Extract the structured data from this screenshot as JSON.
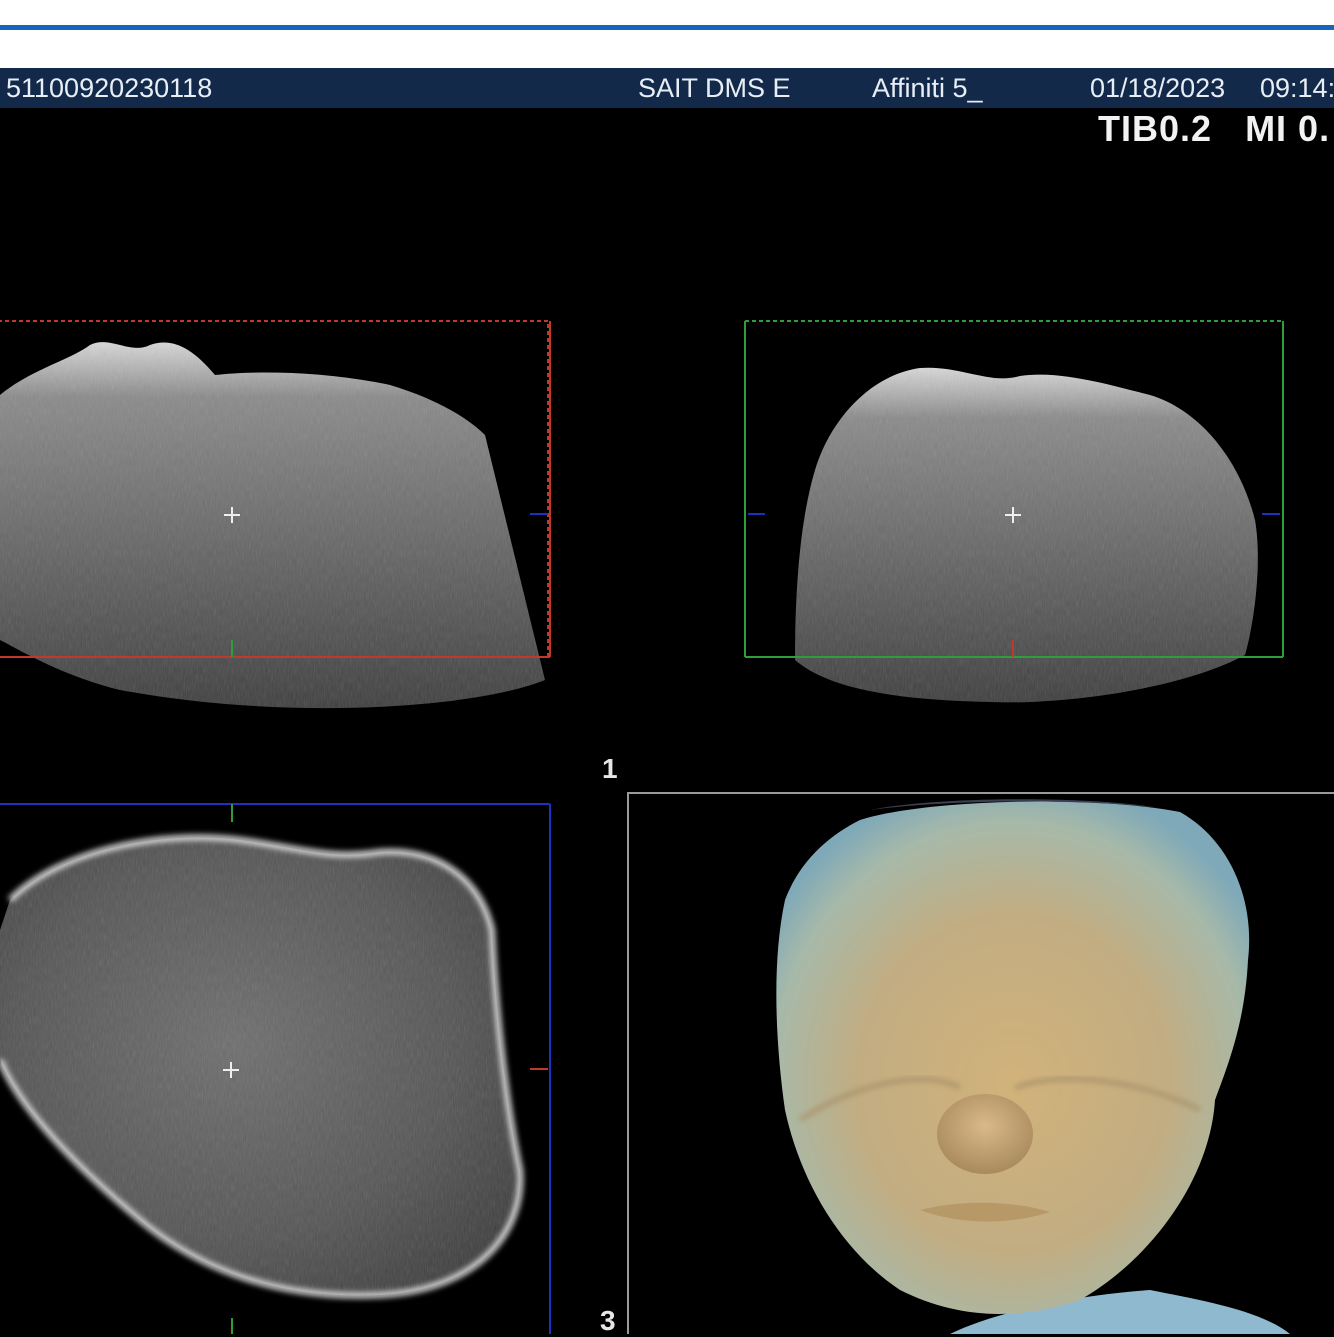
{
  "header": {
    "patient_id": "51100920230118",
    "institution": "SAIT DMS E",
    "system": "Affiniti 5_",
    "date": "01/18/2023",
    "time": "09:14:"
  },
  "indices": {
    "tib": "TIB0.2",
    "mi": "MI 0."
  },
  "panes": {
    "pane1_label": "1",
    "pane3_label": "3"
  },
  "colors": {
    "header_bg": "#13294a",
    "top_line": "#1565c0",
    "plane_a_frame": "#c0392b",
    "plane_b_frame": "#2e9e3a",
    "plane_c_frame": "#1f2fbf"
  }
}
